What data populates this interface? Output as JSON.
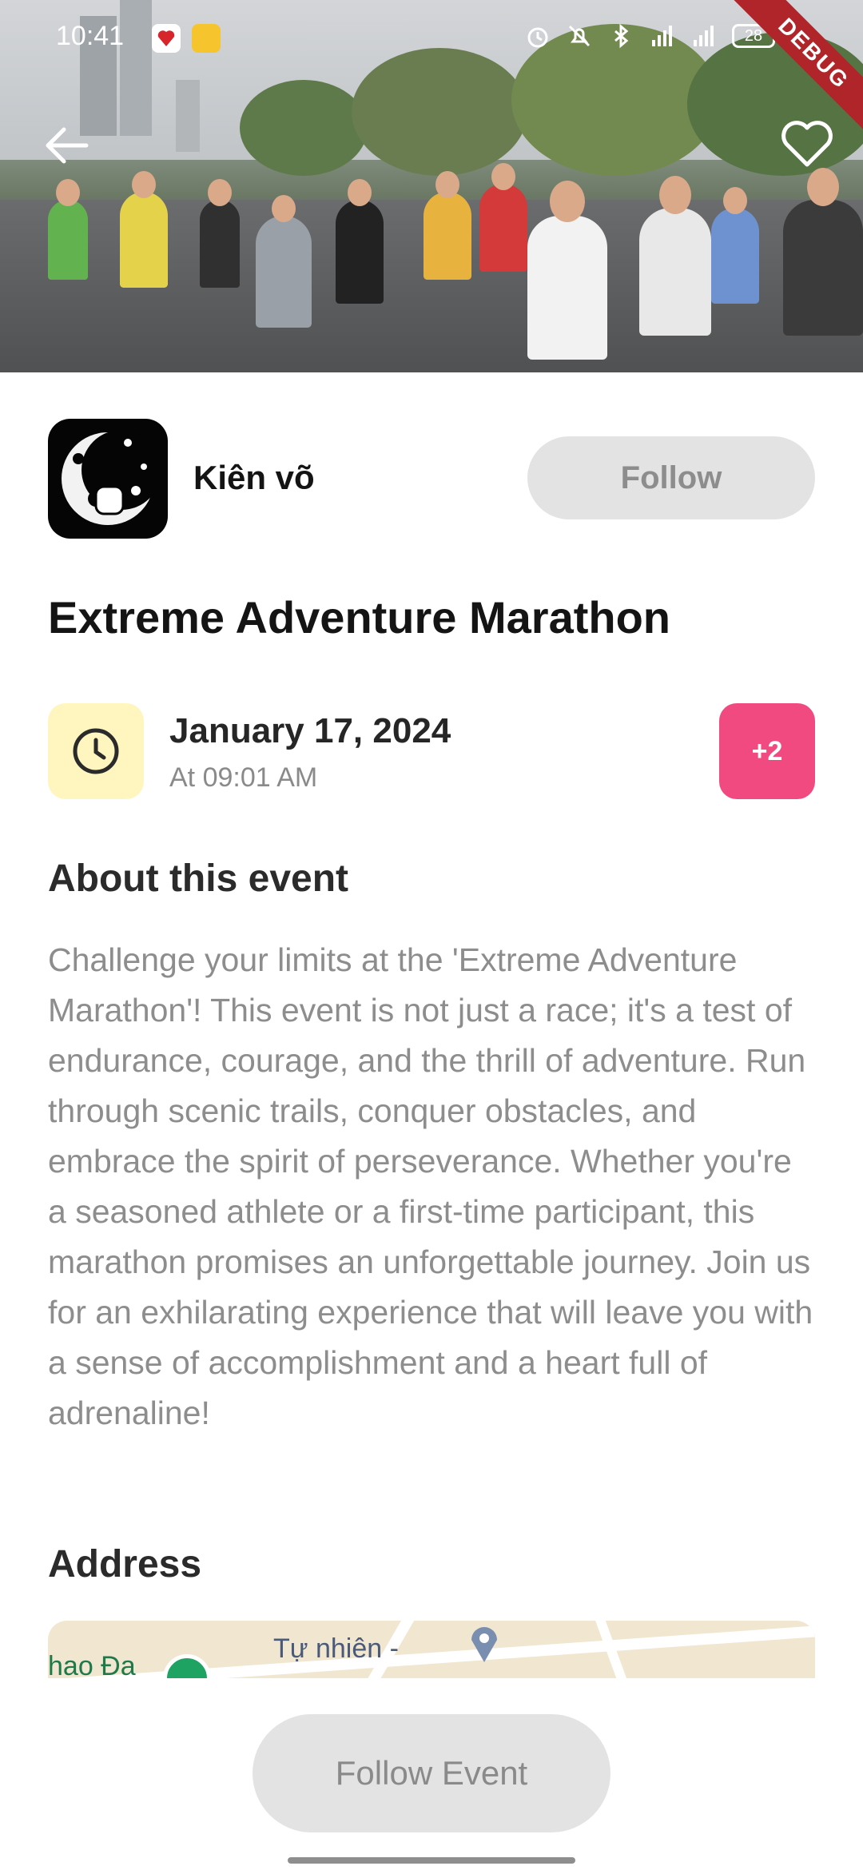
{
  "status_bar": {
    "time": "10:41",
    "battery": "28",
    "debug_label": "DEBUG",
    "icons": [
      "vnpay-icon",
      "taptap-icon",
      "alarm-icon",
      "mute-icon",
      "bluetooth-icon",
      "signal-icon",
      "4g-signal-icon",
      "battery-icon"
    ]
  },
  "header": {
    "back_icon": "arrow-left-icon",
    "favorite_icon": "heart-outline-icon"
  },
  "organizer": {
    "name": "Kiên võ",
    "follow_label": "Follow"
  },
  "event": {
    "title": "Extreme Adventure Marathon",
    "date": "January 17, 2024",
    "time": "At 09:01 AM",
    "attendees_extra": "+2"
  },
  "about": {
    "heading": "About this event",
    "text": "Challenge your limits at the 'Extreme Adventure Marathon'! This event is not just a race; it's a test of endurance, courage, and the thrill of adventure. Run through scenic trails, conquer obstacles, and embrace the spirit of perseverance. Whether you're a seasoned athlete or a first-time participant, this marathon promises an unforgettable journey. Join us for an exhilarating experience that will leave you with a sense of accomplishment and a heart full of adrenaline!"
  },
  "address": {
    "heading": "Address",
    "map_labels": [
      "Tự nhiên -",
      "hao Đa"
    ]
  },
  "footer": {
    "follow_event_label": "Follow Event"
  },
  "colors": {
    "accent_pink": "#f04a80",
    "clock_bg": "#fff6bf",
    "button_gray": "#e3e3e3"
  }
}
